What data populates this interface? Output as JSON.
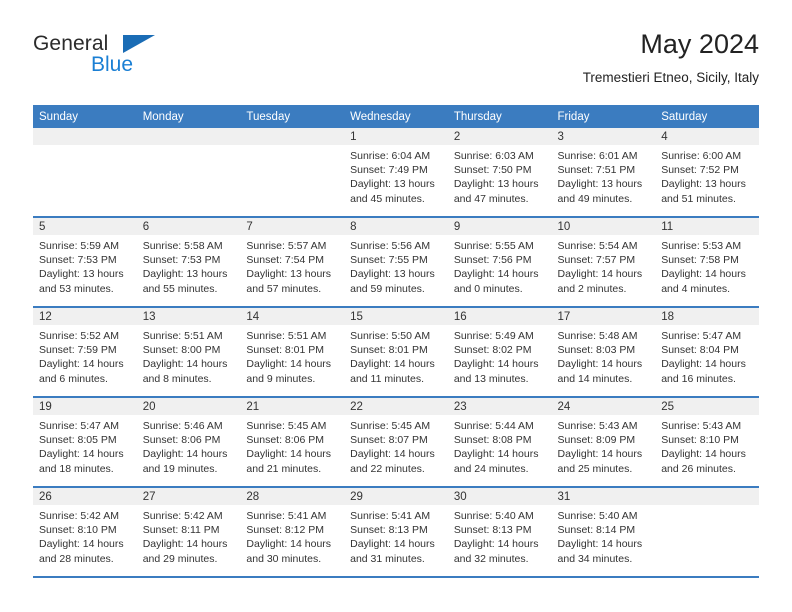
{
  "brand": {
    "name_top": "General",
    "name_bottom": "Blue",
    "accent_color": "#1a7fd4",
    "triangle_color": "#1a6cb5"
  },
  "header": {
    "title": "May 2024",
    "subtitle": "Tremestieri Etneo, Sicily, Italy"
  },
  "calendar": {
    "header_color": "#3b7cc0",
    "daynum_band_color": "#f0f0f0",
    "weekday_names": [
      "Sunday",
      "Monday",
      "Tuesday",
      "Wednesday",
      "Thursday",
      "Friday",
      "Saturday"
    ],
    "weeks": [
      [
        {
          "day": "",
          "sunrise": "",
          "sunset": "",
          "daylight_line1": "",
          "daylight_line2": ""
        },
        {
          "day": "",
          "sunrise": "",
          "sunset": "",
          "daylight_line1": "",
          "daylight_line2": ""
        },
        {
          "day": "",
          "sunrise": "",
          "sunset": "",
          "daylight_line1": "",
          "daylight_line2": ""
        },
        {
          "day": "1",
          "sunrise": "Sunrise: 6:04 AM",
          "sunset": "Sunset: 7:49 PM",
          "daylight_line1": "Daylight: 13 hours",
          "daylight_line2": "and 45 minutes."
        },
        {
          "day": "2",
          "sunrise": "Sunrise: 6:03 AM",
          "sunset": "Sunset: 7:50 PM",
          "daylight_line1": "Daylight: 13 hours",
          "daylight_line2": "and 47 minutes."
        },
        {
          "day": "3",
          "sunrise": "Sunrise: 6:01 AM",
          "sunset": "Sunset: 7:51 PM",
          "daylight_line1": "Daylight: 13 hours",
          "daylight_line2": "and 49 minutes."
        },
        {
          "day": "4",
          "sunrise": "Sunrise: 6:00 AM",
          "sunset": "Sunset: 7:52 PM",
          "daylight_line1": "Daylight: 13 hours",
          "daylight_line2": "and 51 minutes."
        }
      ],
      [
        {
          "day": "5",
          "sunrise": "Sunrise: 5:59 AM",
          "sunset": "Sunset: 7:53 PM",
          "daylight_line1": "Daylight: 13 hours",
          "daylight_line2": "and 53 minutes."
        },
        {
          "day": "6",
          "sunrise": "Sunrise: 5:58 AM",
          "sunset": "Sunset: 7:53 PM",
          "daylight_line1": "Daylight: 13 hours",
          "daylight_line2": "and 55 minutes."
        },
        {
          "day": "7",
          "sunrise": "Sunrise: 5:57 AM",
          "sunset": "Sunset: 7:54 PM",
          "daylight_line1": "Daylight: 13 hours",
          "daylight_line2": "and 57 minutes."
        },
        {
          "day": "8",
          "sunrise": "Sunrise: 5:56 AM",
          "sunset": "Sunset: 7:55 PM",
          "daylight_line1": "Daylight: 13 hours",
          "daylight_line2": "and 59 minutes."
        },
        {
          "day": "9",
          "sunrise": "Sunrise: 5:55 AM",
          "sunset": "Sunset: 7:56 PM",
          "daylight_line1": "Daylight: 14 hours",
          "daylight_line2": "and 0 minutes."
        },
        {
          "day": "10",
          "sunrise": "Sunrise: 5:54 AM",
          "sunset": "Sunset: 7:57 PM",
          "daylight_line1": "Daylight: 14 hours",
          "daylight_line2": "and 2 minutes."
        },
        {
          "day": "11",
          "sunrise": "Sunrise: 5:53 AM",
          "sunset": "Sunset: 7:58 PM",
          "daylight_line1": "Daylight: 14 hours",
          "daylight_line2": "and 4 minutes."
        }
      ],
      [
        {
          "day": "12",
          "sunrise": "Sunrise: 5:52 AM",
          "sunset": "Sunset: 7:59 PM",
          "daylight_line1": "Daylight: 14 hours",
          "daylight_line2": "and 6 minutes."
        },
        {
          "day": "13",
          "sunrise": "Sunrise: 5:51 AM",
          "sunset": "Sunset: 8:00 PM",
          "daylight_line1": "Daylight: 14 hours",
          "daylight_line2": "and 8 minutes."
        },
        {
          "day": "14",
          "sunrise": "Sunrise: 5:51 AM",
          "sunset": "Sunset: 8:01 PM",
          "daylight_line1": "Daylight: 14 hours",
          "daylight_line2": "and 9 minutes."
        },
        {
          "day": "15",
          "sunrise": "Sunrise: 5:50 AM",
          "sunset": "Sunset: 8:01 PM",
          "daylight_line1": "Daylight: 14 hours",
          "daylight_line2": "and 11 minutes."
        },
        {
          "day": "16",
          "sunrise": "Sunrise: 5:49 AM",
          "sunset": "Sunset: 8:02 PM",
          "daylight_line1": "Daylight: 14 hours",
          "daylight_line2": "and 13 minutes."
        },
        {
          "day": "17",
          "sunrise": "Sunrise: 5:48 AM",
          "sunset": "Sunset: 8:03 PM",
          "daylight_line1": "Daylight: 14 hours",
          "daylight_line2": "and 14 minutes."
        },
        {
          "day": "18",
          "sunrise": "Sunrise: 5:47 AM",
          "sunset": "Sunset: 8:04 PM",
          "daylight_line1": "Daylight: 14 hours",
          "daylight_line2": "and 16 minutes."
        }
      ],
      [
        {
          "day": "19",
          "sunrise": "Sunrise: 5:47 AM",
          "sunset": "Sunset: 8:05 PM",
          "daylight_line1": "Daylight: 14 hours",
          "daylight_line2": "and 18 minutes."
        },
        {
          "day": "20",
          "sunrise": "Sunrise: 5:46 AM",
          "sunset": "Sunset: 8:06 PM",
          "daylight_line1": "Daylight: 14 hours",
          "daylight_line2": "and 19 minutes."
        },
        {
          "day": "21",
          "sunrise": "Sunrise: 5:45 AM",
          "sunset": "Sunset: 8:06 PM",
          "daylight_line1": "Daylight: 14 hours",
          "daylight_line2": "and 21 minutes."
        },
        {
          "day": "22",
          "sunrise": "Sunrise: 5:45 AM",
          "sunset": "Sunset: 8:07 PM",
          "daylight_line1": "Daylight: 14 hours",
          "daylight_line2": "and 22 minutes."
        },
        {
          "day": "23",
          "sunrise": "Sunrise: 5:44 AM",
          "sunset": "Sunset: 8:08 PM",
          "daylight_line1": "Daylight: 14 hours",
          "daylight_line2": "and 24 minutes."
        },
        {
          "day": "24",
          "sunrise": "Sunrise: 5:43 AM",
          "sunset": "Sunset: 8:09 PM",
          "daylight_line1": "Daylight: 14 hours",
          "daylight_line2": "and 25 minutes."
        },
        {
          "day": "25",
          "sunrise": "Sunrise: 5:43 AM",
          "sunset": "Sunset: 8:10 PM",
          "daylight_line1": "Daylight: 14 hours",
          "daylight_line2": "and 26 minutes."
        }
      ],
      [
        {
          "day": "26",
          "sunrise": "Sunrise: 5:42 AM",
          "sunset": "Sunset: 8:10 PM",
          "daylight_line1": "Daylight: 14 hours",
          "daylight_line2": "and 28 minutes."
        },
        {
          "day": "27",
          "sunrise": "Sunrise: 5:42 AM",
          "sunset": "Sunset: 8:11 PM",
          "daylight_line1": "Daylight: 14 hours",
          "daylight_line2": "and 29 minutes."
        },
        {
          "day": "28",
          "sunrise": "Sunrise: 5:41 AM",
          "sunset": "Sunset: 8:12 PM",
          "daylight_line1": "Daylight: 14 hours",
          "daylight_line2": "and 30 minutes."
        },
        {
          "day": "29",
          "sunrise": "Sunrise: 5:41 AM",
          "sunset": "Sunset: 8:13 PM",
          "daylight_line1": "Daylight: 14 hours",
          "daylight_line2": "and 31 minutes."
        },
        {
          "day": "30",
          "sunrise": "Sunrise: 5:40 AM",
          "sunset": "Sunset: 8:13 PM",
          "daylight_line1": "Daylight: 14 hours",
          "daylight_line2": "and 32 minutes."
        },
        {
          "day": "31",
          "sunrise": "Sunrise: 5:40 AM",
          "sunset": "Sunset: 8:14 PM",
          "daylight_line1": "Daylight: 14 hours",
          "daylight_line2": "and 34 minutes."
        },
        {
          "day": "",
          "sunrise": "",
          "sunset": "",
          "daylight_line1": "",
          "daylight_line2": ""
        }
      ]
    ]
  }
}
